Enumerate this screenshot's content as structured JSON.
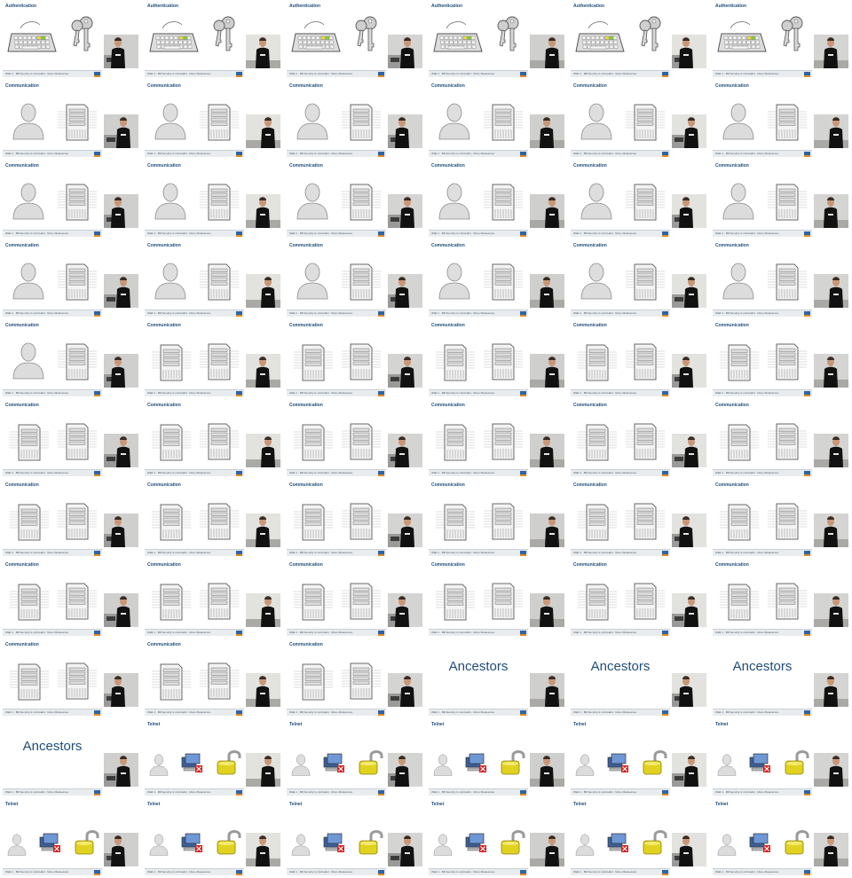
{
  "slides": [
    {
      "title": "Authentication",
      "footer": "Walk 1 · Bill Security is minimalist · Mono Metaverses",
      "left": "keyboard",
      "right": "keys"
    },
    {
      "title": "Authentication",
      "footer": "Walk 1 · Bill Security is minimalist · Mono Metaverses",
      "left": "keyboard",
      "right": "keys"
    },
    {
      "title": "Authentication",
      "footer": "Walk 1 · Bill Security is minimalist · Mono Metaverses",
      "left": "keyboard",
      "right": "keys"
    },
    {
      "title": "Authentication",
      "footer": "Walk 1 · Bill Security is minimalist · Mono Metaverses",
      "left": "keyboard",
      "right": "keys"
    },
    {
      "title": "Authentication",
      "footer": "Walk 1 · Bill Security is minimalist · Mono Metaverses",
      "left": "keyboard",
      "right": "keys"
    },
    {
      "title": "Authentication",
      "footer": "Walk 1 · Bill Security is minimalist · Mono Metaverses",
      "left": "keyboard",
      "right": "keys"
    },
    {
      "title": "Communication",
      "footer": "Walk 1 · Bill Security is minimalist · Mono Metaverses",
      "left": "user",
      "right": "server"
    },
    {
      "title": "Communication",
      "footer": "Walk 1 · Bill Security is minimalist · Mono Metaverses",
      "left": "user",
      "right": "server"
    },
    {
      "title": "Communication",
      "footer": "Walk 1 · Bill Security is minimalist · Mono Metaverses",
      "left": "user",
      "right": "server"
    },
    {
      "title": "Communication",
      "footer": "Walk 1 · Bill Security is minimalist · Mono Metaverses",
      "left": "user",
      "right": "server"
    },
    {
      "title": "Communication",
      "footer": "Walk 1 · Bill Security is minimalist · Mono Metaverses",
      "left": "user",
      "right": "server"
    },
    {
      "title": "Communication",
      "footer": "Walk 1 · Bill Security is minimalist · Mono Metaverses",
      "left": "user",
      "right": "server"
    },
    {
      "title": "Communication",
      "footer": "Walk 1 · Bill Security is minimalist · Mono Metaverses",
      "left": "user",
      "right": "server"
    },
    {
      "title": "Communication",
      "footer": "Walk 1 · Bill Security is minimalist · Mono Metaverses",
      "left": "user",
      "right": "server"
    },
    {
      "title": "Communication",
      "footer": "Walk 1 · Bill Security is minimalist · Mono Metaverses",
      "left": "user",
      "right": "server"
    },
    {
      "title": "Communication",
      "footer": "Walk 1 · Bill Security is minimalist · Mono Metaverses",
      "left": "user",
      "right": "server"
    },
    {
      "title": "Communication",
      "footer": "Walk 1 · Bill Security is minimalist · Mono Metaverses",
      "left": "user",
      "right": "server"
    },
    {
      "title": "Communication",
      "footer": "Walk 1 · Bill Security is minimalist · Mono Metaverses",
      "left": "user",
      "right": "server"
    },
    {
      "title": "Communication",
      "footer": "Walk 1 · Bill Security is minimalist · Mono Metaverses",
      "left": "user",
      "right": "server"
    },
    {
      "title": "Communication",
      "footer": "Walk 1 · Bill Security is minimalist · Mono Metaverses",
      "left": "user",
      "right": "server"
    },
    {
      "title": "Communication",
      "footer": "Walk 1 · Bill Security is minimalist · Mono Metaverses",
      "left": "user",
      "right": "server"
    },
    {
      "title": "Communication",
      "footer": "Walk 1 · Bill Security is minimalist · Mono Metaverses",
      "left": "user",
      "right": "server"
    },
    {
      "title": "Communication",
      "footer": "Walk 1 · Bill Security is minimalist · Mono Metaverses",
      "left": "user",
      "right": "server"
    },
    {
      "title": "Communication",
      "footer": "Walk 1 · Bill Security is minimalist · Mono Metaverses",
      "left": "user",
      "right": "server"
    },
    {
      "title": "Communication",
      "footer": "Walk 1 · Bill Security is minimalist · Mono Metaverses",
      "left": "user",
      "right": "server"
    },
    {
      "title": "Communication",
      "footer": "Walk 1 · Bill Security is minimalist · Mono Metaverses",
      "left": "server",
      "right": "server"
    },
    {
      "title": "Communication",
      "footer": "Walk 1 · Bill Security is minimalist · Mono Metaverses",
      "left": "server",
      "right": "server"
    },
    {
      "title": "Communication",
      "footer": "Walk 1 · Bill Security is minimalist · Mono Metaverses",
      "left": "server",
      "right": "server"
    },
    {
      "title": "Communication",
      "footer": "Walk 1 · Bill Security is minimalist · Mono Metaverses",
      "left": "server",
      "right": "server"
    },
    {
      "title": "Communication",
      "footer": "Walk 1 · Bill Security is minimalist · Mono Metaverses",
      "left": "server",
      "right": "server"
    },
    {
      "title": "Communication",
      "footer": "Walk 1 · Bill Security is minimalist · Mono Metaverses",
      "left": "server",
      "right": "server"
    },
    {
      "title": "Communication",
      "footer": "Walk 1 · Bill Security is minimalist · Mono Metaverses",
      "left": "server",
      "right": "server"
    },
    {
      "title": "Communication",
      "footer": "Walk 1 · Bill Security is minimalist · Mono Metaverses",
      "left": "server",
      "right": "server"
    },
    {
      "title": "Communication",
      "footer": "Walk 1 · Bill Security is minimalist · Mono Metaverses",
      "left": "server",
      "right": "server"
    },
    {
      "title": "Communication",
      "footer": "Walk 1 · Bill Security is minimalist · Mono Metaverses",
      "left": "server",
      "right": "server"
    },
    {
      "title": "Communication",
      "footer": "Walk 1 · Bill Security is minimalist · Mono Metaverses",
      "left": "server",
      "right": "server"
    },
    {
      "title": "Communication",
      "footer": "Walk 1 · Bill Security is minimalist · Mono Metaverses",
      "left": "server",
      "right": "server"
    },
    {
      "title": "Communication",
      "footer": "Walk 1 · Bill Security is minimalist · Mono Metaverses",
      "left": "server",
      "right": "server"
    },
    {
      "title": "Communication",
      "footer": "Walk 1 · Bill Security is minimalist · Mono Metaverses",
      "left": "server",
      "right": "server"
    },
    {
      "title": "Communication",
      "footer": "Walk 1 · Bill Security is minimalist · Mono Metaverses",
      "left": "server",
      "right": "server"
    },
    {
      "title": "Communication",
      "footer": "Walk 1 · Bill Security is minimalist · Mono Metaverses",
      "left": "server",
      "right": "server"
    },
    {
      "title": "Communication",
      "footer": "Walk 1 · Bill Security is minimalist · Mono Metaverses",
      "left": "server",
      "right": "server"
    },
    {
      "title": "Communication",
      "footer": "Walk 1 · Bill Security is minimalist · Mono Metaverses",
      "left": "server",
      "right": "server"
    },
    {
      "title": "Communication",
      "footer": "Walk 1 · Bill Security is minimalist · Mono Metaverses",
      "left": "server",
      "right": "server"
    },
    {
      "title": "Communication",
      "footer": "Walk 1 · Bill Security is minimalist · Mono Metaverses",
      "left": "server",
      "right": "server"
    },
    {
      "title": "Communication",
      "footer": "Walk 1 · Bill Security is minimalist · Mono Metaverses",
      "left": "server",
      "right": "server"
    },
    {
      "title": "Communication",
      "footer": "Walk 1 · Bill Security is minimalist · Mono Metaverses",
      "left": "server",
      "right": "server"
    },
    {
      "title": "Communication",
      "footer": "Walk 1 · Bill Security is minimalist · Mono Metaverses",
      "left": "server",
      "right": "server"
    },
    {
      "title": "Communication",
      "footer": "Walk 1 · Bill Security is minimalist · Mono Metaverses",
      "left": "server",
      "right": "server"
    },
    {
      "title": "Communication",
      "footer": "Walk 1 · Bill Security is minimalist · Mono Metaverses",
      "left": "server",
      "right": "server"
    },
    {
      "title": "Communication",
      "footer": "Walk 1 · Bill Security is minimalist · Mono Metaverses",
      "left": "server",
      "right": "server"
    },
    {
      "big": "Ancestors",
      "footer": "Walk 1 · Bill Security is minimalist · Mono Metaverses"
    },
    {
      "big": "Ancestors",
      "footer": "Walk 1 · Bill Security is minimalist · Mono Metaverses"
    },
    {
      "big": "Ancestors",
      "footer": "Walk 1 · Bill Security is minimalist · Mono Metaverses"
    },
    {
      "big": "Ancestors",
      "footer": "Walk 1 · Bill Security is minimalist · Mono Metaverses"
    },
    {
      "title": "Telnet",
      "footer": "Walk 1 · Bill Security is minimalist · Mono Metaverses",
      "telnet": true
    },
    {
      "title": "Telnet",
      "footer": "Walk 1 · Bill Security is minimalist · Mono Metaverses",
      "telnet": true
    },
    {
      "title": "Telnet",
      "footer": "Walk 1 · Bill Security is minimalist · Mono Metaverses",
      "telnet": true
    },
    {
      "title": "Telnet",
      "footer": "Walk 1 · Bill Security is minimalist · Mono Metaverses",
      "telnet": true
    },
    {
      "title": "Telnet",
      "footer": "Walk 1 · Bill Security is minimalist · Mono Metaverses",
      "telnet": true
    },
    {
      "title": "Telnet",
      "footer": "Walk 1 · Bill Security is minimalist · Mono Metaverses",
      "telnet": true
    },
    {
      "title": "Telnet",
      "footer": "Walk 1 · Bill Security is minimalist · Mono Metaverses",
      "telnet": true
    },
    {
      "title": "Telnet",
      "footer": "Walk 1 · Bill Security is minimalist · Mono Metaverses",
      "telnet": true
    },
    {
      "title": "Telnet",
      "footer": "Walk 1 · Bill Security is minimalist · Mono Metaverses",
      "telnet": true
    },
    {
      "title": "Telnet",
      "footer": "Walk 1 · Bill Security is minimalist · Mono Metaverses",
      "telnet": true
    },
    {
      "title": "Telnet",
      "footer": "Walk 1 · Bill Security is minimalist · Mono Metaverses",
      "telnet": true
    }
  ],
  "colors": {
    "title": "#1f4d7a",
    "footer_bg": "#e9ecef",
    "logo_blue": "#2d64a8",
    "logo_orange": "#e28a1e",
    "shirt": "#111111",
    "skin": "#c99777",
    "hair": "#3b2b22",
    "video_bg": "#d8d8d6"
  }
}
